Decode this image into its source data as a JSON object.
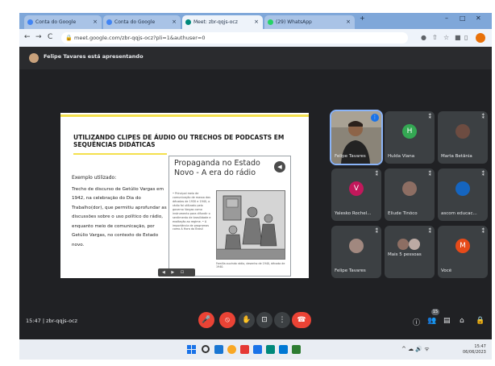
{
  "browser": {
    "tabs": [
      {
        "label": "Conta do Google",
        "favicon_color": "#4285f4",
        "active": false
      },
      {
        "label": "Conta do Google",
        "favicon_color": "#4285f4",
        "active": false
      },
      {
        "label": "Meet: zbr-qqjs-ocz",
        "favicon_color": "#00897b",
        "active": true
      },
      {
        "label": "(29) WhatsApp",
        "favicon_color": "#25d366",
        "active": false
      }
    ],
    "new_tab": "+",
    "url": "meet.google.com/zbr-qqjs-ocz?pli=1&authuser=0",
    "nav": {
      "back": "←",
      "forward": "→",
      "reload": "C"
    },
    "window_controls": {
      "minimize": "–",
      "maximize": "□",
      "close": "✕"
    }
  },
  "meet": {
    "presenter_notice": "Felipe Tavares está apresentando",
    "meeting_time": "15:47",
    "meeting_code": "zbr-qqjs-ocz",
    "people_count": "15"
  },
  "slide": {
    "heading": "UTILIZANDO CLIPES DE ÁUDIO OU TRECHOS DE PODCASTS EM SEQUÊNCIAS DIDÁTICAS",
    "example_label": "Exemplo utilizado:",
    "example_body": "Trecho de discurso de Getúlio Vargas em 1942, na celebração do Dia do Trabalho(dor), que permitiu aprofundar as discussões sobre o uso político do rádio, enquanto meio de comunicação, por Getúlio Vargas, no contexto do Estado novo.",
    "inner_title": "Propaganda no Estado Novo - A era do rádio",
    "inner_bullets": "• Principal meio de comunicação de massa das décadas de 1930 e 1940, o rádio foi utilizado pelo governo Vargas como instrumento para difundir o sentimento de brasilidade e exaltação ao regime. • A importância de programas como A Hora do Brasil",
    "inner_caption": "Família ouvindo rádio, desenho de 1940, década de 1940."
  },
  "participants": [
    {
      "name": "Felipe Tavares",
      "initial": "",
      "color": "#7a5a44",
      "video": true,
      "speaking": true
    },
    {
      "name": "Hulda Viana",
      "initial": "H",
      "color": "#34a853",
      "video": false,
      "speaking": false
    },
    {
      "name": "Marta Betânia",
      "initial": "",
      "color": "#6d4c41",
      "video": false,
      "speaking": false
    },
    {
      "name": "Yalesko Rochel...",
      "initial": "V",
      "color": "#c2185b",
      "video": false,
      "speaking": false
    },
    {
      "name": "Eliude Tinôco",
      "initial": "",
      "color": "#8d6e63",
      "video": false,
      "speaking": false
    },
    {
      "name": "ascom educac...",
      "initial": "",
      "color": "#1565c0",
      "video": false,
      "speaking": false
    },
    {
      "name": "Felipe Tavares",
      "initial": "",
      "color": "#a1887f",
      "video": false,
      "speaking": false
    },
    {
      "name": "Mais 5 pessoas",
      "initial": "",
      "color": "#8d6e63",
      "video": false,
      "speaking": false
    },
    {
      "name": "Você",
      "initial": "M",
      "color": "#e64a19",
      "video": false,
      "speaking": false
    }
  ],
  "controls": {
    "mic": "🎤",
    "camera": "⦸",
    "raise_hand": "✋",
    "present": "⊡",
    "more": "⋮",
    "leave": "☎",
    "info": "ⓘ",
    "people": "👥",
    "chat": "▤",
    "activities": "⌂",
    "lock": "🔒"
  },
  "taskbar": {
    "icon_colors": [
      "#333333",
      "#1976d2",
      "#f9a825",
      "#e53935",
      "#1a73e8",
      "#00897b",
      "#0078d4",
      "#2e7d32"
    ],
    "tray": "^ ☁ 🔊 ᯤ",
    "time": "15:47",
    "date": "06/06/2023"
  }
}
